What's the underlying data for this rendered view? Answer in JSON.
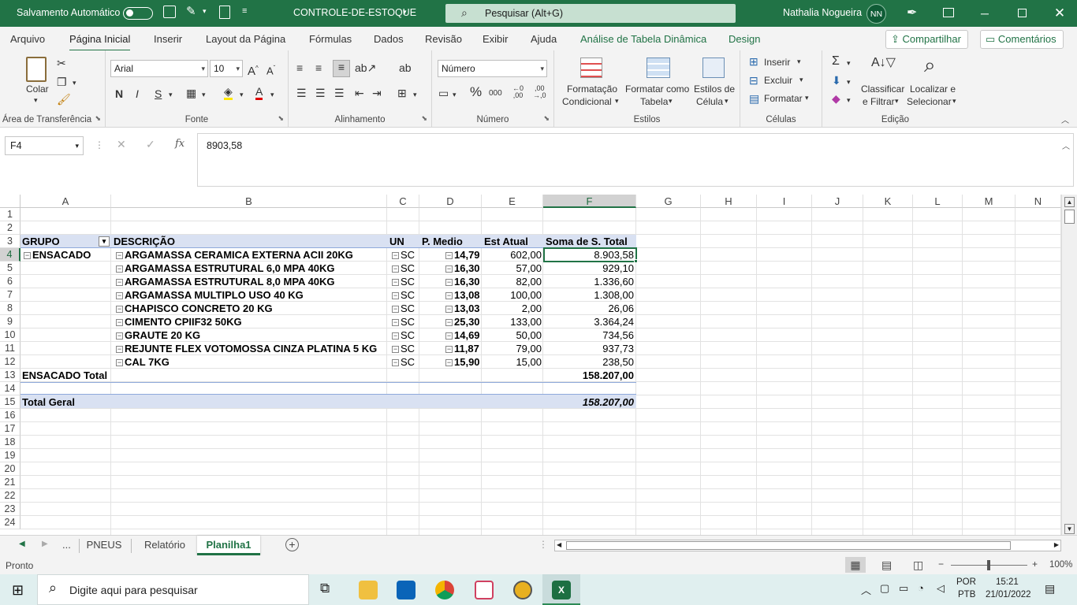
{
  "titlebar": {
    "autosave_label": "Salvamento Automático",
    "filename": "CONTROLE-DE-ESTOQUE",
    "search_placeholder": "Pesquisar (Alt+G)",
    "user_name": "Nathalia Nogueira",
    "user_initials": "NN"
  },
  "menu": {
    "tabs": [
      "Arquivo",
      "Página Inicial",
      "Inserir",
      "Layout da Página",
      "Fórmulas",
      "Dados",
      "Revisão",
      "Exibir",
      "Ajuda",
      "Análise de Tabela Dinâmica",
      "Design"
    ],
    "active_tab": "Página Inicial",
    "share_label": "Compartilhar",
    "comments_label": "Comentários"
  },
  "ribbon": {
    "clipboard": {
      "paste_label": "Colar",
      "group_label": "Área de Transferência"
    },
    "font": {
      "font_name": "Arial",
      "font_size": "10",
      "bold": "N",
      "italic": "I",
      "underline": "S",
      "group_label": "Fonte"
    },
    "alignment": {
      "group_label": "Alinhamento"
    },
    "number": {
      "format": "Número",
      "percent": "%",
      "thousands": "000",
      "group_label": "Número"
    },
    "styles": {
      "cond_format_1": "Formatação",
      "cond_format_2": "Condicional",
      "format_table_1": "Formatar como",
      "format_table_2": "Tabela",
      "cell_styles_1": "Estilos de",
      "cell_styles_2": "Célula",
      "group_label": "Estilos"
    },
    "cells": {
      "insert": "Inserir",
      "delete": "Excluir",
      "format": "Formatar",
      "group_label": "Células"
    },
    "editing": {
      "sort_1": "Classificar",
      "sort_2": "e Filtrar",
      "find_1": "Localizar e",
      "find_2": "Selecionar",
      "group_label": "Edição"
    }
  },
  "formula_bar": {
    "name_box": "F4",
    "fx_label": "fx",
    "formula": "8903,58"
  },
  "grid": {
    "columns": [
      "A",
      "B",
      "C",
      "D",
      "E",
      "F",
      "G",
      "H",
      "I",
      "J",
      "K",
      "L",
      "M",
      "N"
    ],
    "rows": [
      "1",
      "2",
      "3",
      "4",
      "5",
      "6",
      "7",
      "8",
      "9",
      "10",
      "11",
      "12",
      "13",
      "14",
      "15",
      "16",
      "17",
      "18",
      "19",
      "20",
      "21",
      "22",
      "23",
      "24"
    ],
    "selected_cell": "F4",
    "header": {
      "grupo": "GRUPO",
      "descricao": "DESCRIÇÃO",
      "un": "UN",
      "p_medio": "P. Medio",
      "est_atual": "Est Atual",
      "soma": "Soma de S. Total"
    },
    "group_name": "ENSACADO",
    "items": [
      {
        "desc": "ARGAMASSA CERAMICA EXTERNA ACII 20KG",
        "un": "SC",
        "pm": "14,79",
        "est": "602,00",
        "total": "8.903,58"
      },
      {
        "desc": "ARGAMASSA ESTRUTURAL 6,0 MPA 40KG",
        "un": "SC",
        "pm": "16,30",
        "est": "57,00",
        "total": "929,10"
      },
      {
        "desc": "ARGAMASSA ESTRUTURAL 8,0 MPA 40KG",
        "un": "SC",
        "pm": "16,30",
        "est": "82,00",
        "total": "1.336,60"
      },
      {
        "desc": "ARGAMASSA MULTIPLO USO 40 KG",
        "un": "SC",
        "pm": "13,08",
        "est": "100,00",
        "total": "1.308,00"
      },
      {
        "desc": "CHAPISCO CONCRETO 20 KG",
        "un": "SC",
        "pm": "13,03",
        "est": "2,00",
        "total": "26,06"
      },
      {
        "desc": "CIMENTO CPIIF32 50KG",
        "un": "SC",
        "pm": "25,30",
        "est": "133,00",
        "total": "3.364,24"
      },
      {
        "desc": "GRAUTE 20 KG",
        "un": "SC",
        "pm": "14,69",
        "est": "50,00",
        "total": "734,56"
      },
      {
        "desc": "REJUNTE FLEX VOTOMOSSA CINZA PLATINA 5 KG",
        "un": "SC",
        "pm": "11,87",
        "est": "79,00",
        "total": "937,73"
      },
      {
        "desc": "CAL 7KG",
        "un": "SC",
        "pm": "15,90",
        "est": "15,00",
        "total": "238,50"
      }
    ],
    "group_total_label": "ENSACADO Total",
    "group_total": "158.207,00",
    "grand_total_label": "Total Geral",
    "grand_total": "158.207,00"
  },
  "sheets": {
    "ellipsis": "...",
    "tabs": [
      "PNEUS",
      "Relatório",
      "Planilha1"
    ],
    "active": "Planilha1"
  },
  "status": {
    "ready": "Pronto",
    "zoom": "100%"
  },
  "taskbar": {
    "search_placeholder": "Digite aqui para pesquisar",
    "lang_1": "POR",
    "lang_2": "PTB",
    "time": "15:21",
    "date": "21/01/2022"
  },
  "colors": {
    "excel_green": "#217346",
    "pivot_header": "#d9e1f2"
  }
}
